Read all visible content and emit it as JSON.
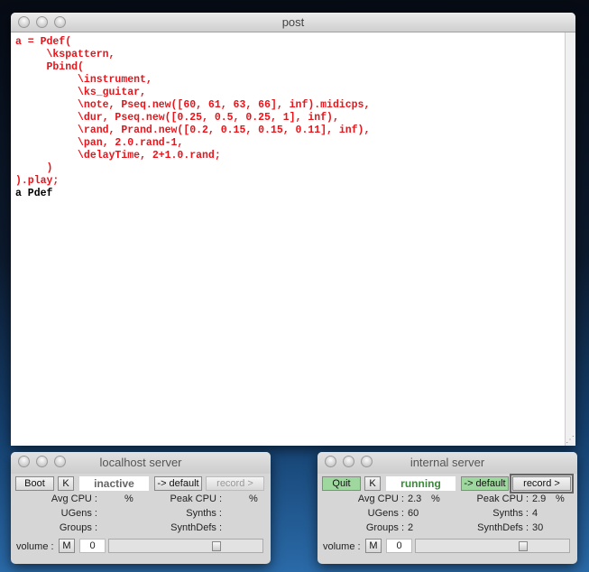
{
  "post": {
    "title": "post",
    "lines": [
      "a = Pdef(",
      "     \\kspattern,",
      "     Pbind(",
      "          \\instrument,",
      "          \\ks_guitar,",
      "          \\note, Pseq.new([60, 61, 63, 66], inf).midicps,",
      "          \\dur, Pseq.new([0.25, 0.5, 0.25, 1], inf),",
      "          \\rand, Prand.new([0.2, 0.15, 0.15, 0.11], inf),",
      "          \\pan, 2.0.rand-1,",
      "          \\delayTime, 2+1.0.rand;",
      "     )",
      ").play;"
    ],
    "output": "a Pdef"
  },
  "localhost": {
    "title": "localhost server",
    "boot": "Boot",
    "kill": "K",
    "status": "inactive",
    "default": "-> default",
    "record": "record >",
    "avg_cpu_label": "Avg CPU :",
    "avg_cpu": "",
    "pct": "%",
    "peak_cpu_label": "Peak CPU :",
    "peak_cpu": "",
    "ugens_label": "UGens :",
    "ugens": "",
    "synths_label": "Synths :",
    "synths": "",
    "groups_label": "Groups :",
    "groups": "",
    "synthdefs_label": "SynthDefs :",
    "synthdefs": "",
    "volume_label": "volume :",
    "mute": "M",
    "volume": "0",
    "volume_slider": 0.7
  },
  "internal": {
    "title": "internal server",
    "boot": "Quit",
    "kill": "K",
    "status": "running",
    "default": "-> default",
    "record": "record >",
    "avg_cpu_label": "Avg CPU :",
    "avg_cpu": "2.3",
    "pct": "%",
    "peak_cpu_label": "Peak CPU :",
    "peak_cpu": "2.9",
    "ugens_label": "UGens :",
    "ugens": "60",
    "synths_label": "Synths :",
    "synths": "4",
    "groups_label": "Groups :",
    "groups": "2",
    "synthdefs_label": "SynthDefs :",
    "synthdefs": "30",
    "volume_label": "volume :",
    "mute": "M",
    "volume": "0",
    "volume_slider": 0.7
  }
}
